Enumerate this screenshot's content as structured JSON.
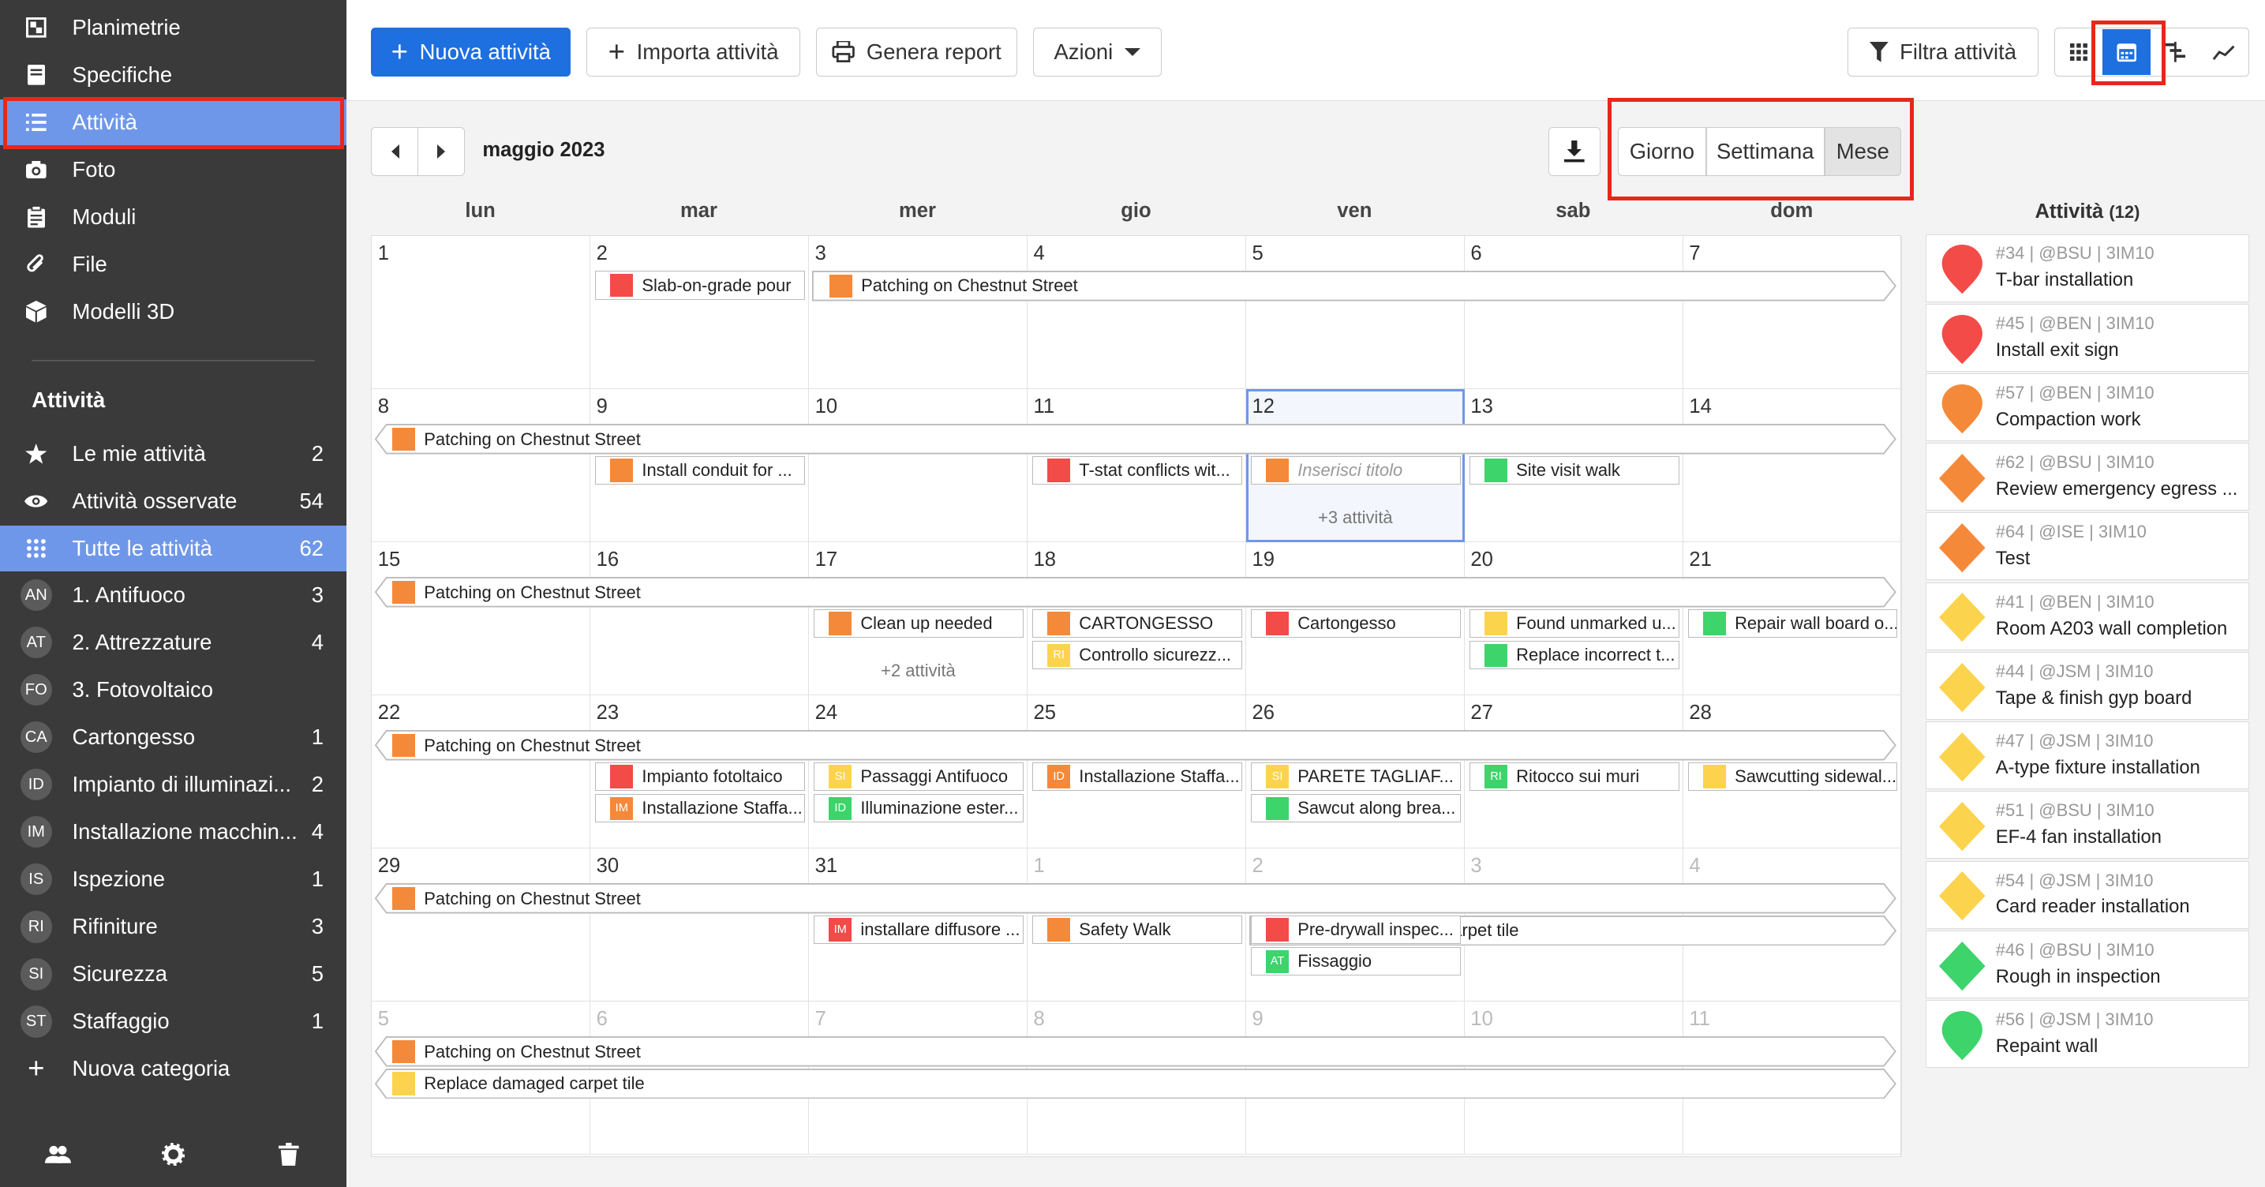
{
  "colors": {
    "red": "#f24b48",
    "orange": "#f5893a",
    "yellow": "#fcd34d",
    "green": "#3dd46b",
    "blue": "#1e6fe0",
    "sidebar": "#3a3a3a",
    "sidebar_active": "#6f97e9",
    "highlight": "#e8271b"
  },
  "sidebar": {
    "top_items": [
      {
        "label": "Planimetrie",
        "icon": "map-icon"
      },
      {
        "label": "Specifiche",
        "icon": "book-icon"
      },
      {
        "label": "Attività",
        "icon": "list-icon"
      },
      {
        "label": "Foto",
        "icon": "camera-icon"
      },
      {
        "label": "Moduli",
        "icon": "clipboard-icon"
      },
      {
        "label": "File",
        "icon": "paperclip-icon"
      },
      {
        "label": "Modelli 3D",
        "icon": "cube-icon"
      }
    ],
    "section_title": "Attività",
    "filters": [
      {
        "label": "Le mie attività",
        "count": "2",
        "icon": "star-icon"
      },
      {
        "label": "Attività osservate",
        "count": "54",
        "icon": "eye-icon"
      },
      {
        "label": "Tutte le attività",
        "count": "62",
        "icon": "grid-icon"
      }
    ],
    "categories": [
      {
        "abbr": "AN",
        "label": "1. Antifuoco",
        "count": "3"
      },
      {
        "abbr": "AT",
        "label": "2. Attrezzature",
        "count": "4"
      },
      {
        "abbr": "FO",
        "label": "3. Fotovoltaico",
        "count": ""
      },
      {
        "abbr": "CA",
        "label": "Cartongesso",
        "count": "1"
      },
      {
        "abbr": "ID",
        "label": "Impianto di illuminazi...",
        "count": "2"
      },
      {
        "abbr": "IM",
        "label": "Installazione macchin...",
        "count": "4"
      },
      {
        "abbr": "IS",
        "label": "Ispezione",
        "count": "1"
      },
      {
        "abbr": "RI",
        "label": "Rifiniture",
        "count": "3"
      },
      {
        "abbr": "SI",
        "label": "Sicurezza",
        "count": "5"
      },
      {
        "abbr": "ST",
        "label": "Staffaggio",
        "count": "1"
      }
    ],
    "new_category": "Nuova categoria"
  },
  "toolbar": {
    "new": "Nuova attività",
    "import": "Importa attività",
    "report": "Genera report",
    "actions": "Azioni",
    "filter": "Filtra attività"
  },
  "calendar": {
    "month": "maggio 2023",
    "views": [
      "Giorno",
      "Settimana",
      "Mese"
    ],
    "active_view": "Mese",
    "weekdays": [
      "lun",
      "mar",
      "mer",
      "gio",
      "ven",
      "sab",
      "dom"
    ],
    "weeks": [
      [
        "1",
        "2",
        "3",
        "4",
        "5",
        "6",
        "7"
      ],
      [
        "8",
        "9",
        "10",
        "11",
        "12",
        "13",
        "14"
      ],
      [
        "15",
        "16",
        "17",
        "18",
        "19",
        "20",
        "21"
      ],
      [
        "22",
        "23",
        "24",
        "25",
        "26",
        "27",
        "28"
      ],
      [
        "29",
        "30",
        "31",
        "1",
        "2",
        "3",
        "4"
      ],
      [
        "5",
        "6",
        "7",
        "8",
        "9",
        "10",
        "11"
      ]
    ],
    "today": "12",
    "spanning": [
      {
        "week": 0,
        "from": 2,
        "to": 6,
        "text": "Patching on Chestnut Street",
        "color": "orange",
        "row": 0
      },
      {
        "week": 1,
        "from": 0,
        "to": 6,
        "text": "Patching on Chestnut Street",
        "color": "orange",
        "row": 0
      },
      {
        "week": 2,
        "from": 0,
        "to": 6,
        "text": "Patching on Chestnut Street",
        "color": "orange",
        "row": 0
      },
      {
        "week": 3,
        "from": 0,
        "to": 6,
        "text": "Patching on Chestnut Street",
        "color": "orange",
        "row": 0
      },
      {
        "week": 4,
        "from": 0,
        "to": 6,
        "text": "Patching on Chestnut Street",
        "color": "orange",
        "row": 0
      },
      {
        "week": 4,
        "from": 4,
        "to": 6,
        "text": "Replace damaged carpet tile",
        "color": "yellow",
        "row": 1,
        "wide": true
      },
      {
        "week": 5,
        "from": 0,
        "to": 6,
        "text": "Patching on Chestnut Street",
        "color": "orange",
        "row": 0
      },
      {
        "week": 5,
        "from": 0,
        "to": 6,
        "text": "Replace damaged carpet tile",
        "color": "yellow",
        "row": 1
      }
    ],
    "events": [
      {
        "week": 0,
        "day": 1,
        "row": 0,
        "text": "Slab-on-grade pour",
        "color": "red"
      },
      {
        "week": 1,
        "day": 1,
        "row": 1,
        "text": "Install conduit for ...",
        "color": "orange"
      },
      {
        "week": 1,
        "day": 3,
        "row": 1,
        "text": "T-stat conflicts wit...",
        "color": "red"
      },
      {
        "week": 1,
        "day": 4,
        "row": 1,
        "text": "Inserisci titolo",
        "color": "orange",
        "placeholder": true
      },
      {
        "week": 1,
        "day": 5,
        "row": 1,
        "text": "Site visit walk",
        "color": "green"
      },
      {
        "week": 2,
        "day": 2,
        "row": 1,
        "text": "Clean up needed",
        "color": "orange"
      },
      {
        "week": 2,
        "day": 3,
        "row": 1,
        "text": "CARTONGESSO",
        "color": "orange"
      },
      {
        "week": 2,
        "day": 3,
        "row": 2,
        "text": "Controllo sicurezz...",
        "color": "yellow",
        "abbr": "RI"
      },
      {
        "week": 2,
        "day": 4,
        "row": 1,
        "text": "Cartongesso",
        "color": "red"
      },
      {
        "week": 2,
        "day": 5,
        "row": 1,
        "text": "Found unmarked u...",
        "color": "yellow"
      },
      {
        "week": 2,
        "day": 5,
        "row": 2,
        "text": "Replace incorrect t...",
        "color": "green"
      },
      {
        "week": 2,
        "day": 6,
        "row": 1,
        "text": "Repair wall board o...",
        "color": "green"
      },
      {
        "week": 3,
        "day": 1,
        "row": 1,
        "text": "Impianto fotoltaico",
        "color": "red"
      },
      {
        "week": 3,
        "day": 1,
        "row": 2,
        "text": "Installazione Staffa...",
        "color": "orange",
        "abbr": "IM"
      },
      {
        "week": 3,
        "day": 2,
        "row": 1,
        "text": "Passaggi Antifuoco",
        "color": "yellow",
        "abbr": "SI"
      },
      {
        "week": 3,
        "day": 2,
        "row": 2,
        "text": "Illuminazione ester...",
        "color": "green",
        "abbr": "ID"
      },
      {
        "week": 3,
        "day": 3,
        "row": 1,
        "text": "Installazione Staffa...",
        "color": "orange",
        "abbr": "ID"
      },
      {
        "week": 3,
        "day": 4,
        "row": 1,
        "text": "PARETE TAGLIAF...",
        "color": "yellow",
        "abbr": "SI"
      },
      {
        "week": 3,
        "day": 4,
        "row": 2,
        "text": "Sawcut along brea...",
        "color": "green"
      },
      {
        "week": 3,
        "day": 5,
        "row": 1,
        "text": "Ritocco sui muri",
        "color": "green",
        "abbr": "RI"
      },
      {
        "week": 3,
        "day": 6,
        "row": 1,
        "text": "Sawcutting sidewal...",
        "color": "yellow"
      },
      {
        "week": 4,
        "day": 2,
        "row": 1,
        "text": "installare diffusore ...",
        "color": "red",
        "abbr": "IM"
      },
      {
        "week": 4,
        "day": 3,
        "row": 1,
        "text": "Safety Walk",
        "color": "orange"
      },
      {
        "week": 4,
        "day": 4,
        "row": 1,
        "text": "Pre-drywall inspec...",
        "color": "red"
      },
      {
        "week": 4,
        "day": 4,
        "row": 2,
        "text": "Fissaggio",
        "color": "green",
        "abbr": "AT"
      }
    ],
    "more": [
      {
        "week": 1,
        "day": 4,
        "text": "+3 attività"
      },
      {
        "week": 2,
        "day": 2,
        "text": "+2 attività"
      }
    ]
  },
  "panel": {
    "title": "Attività",
    "count": "(12)",
    "items": [
      {
        "meta": "#34 | @BSU | 3IM10",
        "title": "T-bar installation",
        "color": "red",
        "shape": "pin"
      },
      {
        "meta": "#45 | @BEN | 3IM10",
        "title": "Install exit sign",
        "color": "red",
        "shape": "pin"
      },
      {
        "meta": "#57 | @BEN | 3IM10",
        "title": "Compaction work",
        "color": "orange",
        "shape": "pin"
      },
      {
        "meta": "#62 | @BSU | 3IM10",
        "title": "Review emergency egress ...",
        "color": "orange",
        "shape": "diamond"
      },
      {
        "meta": "#64 | @ISE | 3IM10",
        "title": "Test",
        "color": "orange",
        "shape": "diamond"
      },
      {
        "meta": "#41 | @BEN | 3IM10",
        "title": "Room A203 wall completion",
        "color": "yellow",
        "shape": "diamond"
      },
      {
        "meta": "#44 | @JSM | 3IM10",
        "title": "Tape & finish gyp board",
        "color": "yellow",
        "shape": "diamond"
      },
      {
        "meta": "#47 | @JSM | 3IM10",
        "title": "A-type fixture installation",
        "color": "yellow",
        "shape": "diamond"
      },
      {
        "meta": "#51 | @BSU | 3IM10",
        "title": "EF-4 fan installation",
        "color": "yellow",
        "shape": "diamond"
      },
      {
        "meta": "#54 | @JSM | 3IM10",
        "title": "Card reader installation",
        "color": "yellow",
        "shape": "diamond"
      },
      {
        "meta": "#46 | @BSU | 3IM10",
        "title": "Rough in inspection",
        "color": "green",
        "shape": "diamond"
      },
      {
        "meta": "#56 | @JSM | 3IM10",
        "title": "Repaint wall",
        "color": "green",
        "shape": "pin"
      }
    ]
  }
}
